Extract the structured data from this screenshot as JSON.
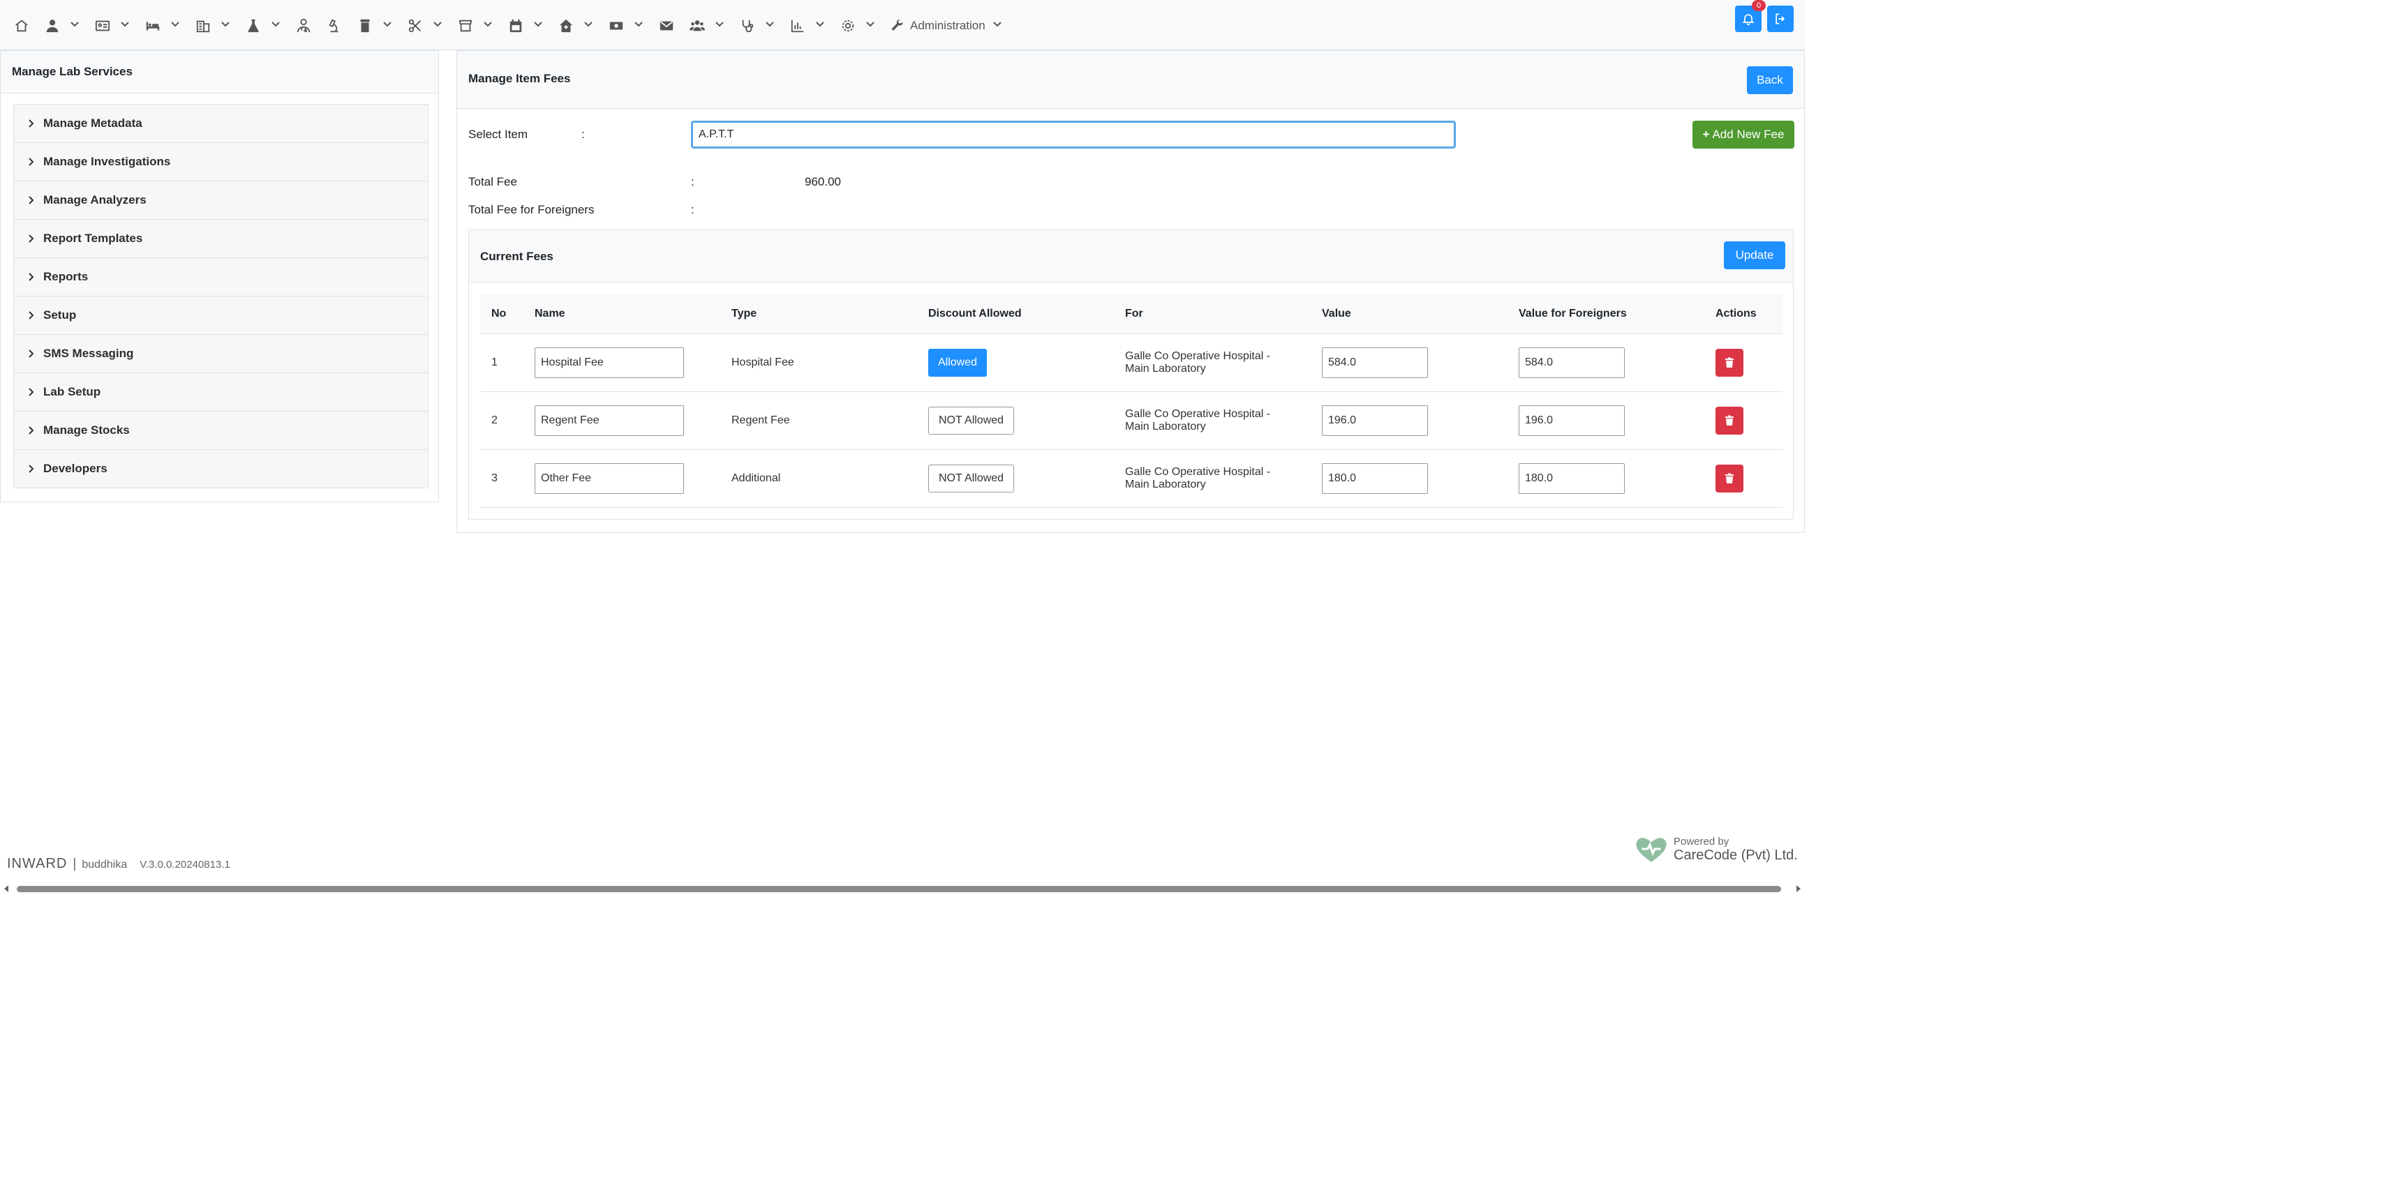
{
  "navbar": {
    "icons": [
      "home-icon",
      "user-icon",
      "id-card-icon",
      "bed-icon",
      "building-icon",
      "flask-icon",
      "user-doctor-icon",
      "microscope-icon",
      "prescription-bottle-icon",
      "scissors-icon",
      "store-icon",
      "calendar-icon",
      "house-medical-icon",
      "money-bill-icon",
      "envelope-icon",
      "users-icon",
      "stethoscope-icon",
      "chart-icon",
      "gear-icon"
    ],
    "admin_label": "Administration",
    "notification_count": "0"
  },
  "sidebar": {
    "title": "Manage Lab Services",
    "items": [
      {
        "label": "Manage Metadata"
      },
      {
        "label": "Manage Investigations"
      },
      {
        "label": "Manage Analyzers"
      },
      {
        "label": "Report Templates"
      },
      {
        "label": "Reports"
      },
      {
        "label": "Setup"
      },
      {
        "label": "SMS Messaging"
      },
      {
        "label": "Lab Setup"
      },
      {
        "label": "Manage Stocks"
      },
      {
        "label": "Developers"
      }
    ]
  },
  "main": {
    "title": "Manage Item Fees",
    "back_label": "Back",
    "select_item_label": "Select Item",
    "colon": ":",
    "select_item_value": "A.P.T.T",
    "add_new_fee_label": "Add New Fee",
    "total_fee_label": "Total Fee",
    "total_fee_value": "960.00",
    "total_fee_foreigners_label": "Total Fee for Foreigners",
    "total_fee_foreigners_value": ""
  },
  "current_fees": {
    "title": "Current Fees",
    "update_label": "Update",
    "columns": {
      "no": "No",
      "name": "Name",
      "type": "Type",
      "discount": "Discount Allowed",
      "for": "For",
      "value": "Value",
      "value_foreigners": "Value for Foreigners",
      "actions": "Actions"
    },
    "rows": [
      {
        "no": "1",
        "name": "Hospital Fee",
        "type": "Hospital Fee",
        "discount": "Allowed",
        "discount_on": true,
        "for_line1": "Galle Co Operative Hospital -",
        "for_line2": "Main Laboratory",
        "value": "584.0",
        "value_foreigners": "584.0"
      },
      {
        "no": "2",
        "name": "Regent Fee",
        "type": "Regent Fee",
        "discount": "NOT Allowed",
        "discount_on": false,
        "for_line1": "Galle Co Operative Hospital -",
        "for_line2": "Main Laboratory",
        "value": "196.0",
        "value_foreigners": "196.0"
      },
      {
        "no": "3",
        "name": "Other Fee",
        "type": "Additional",
        "discount": "NOT Allowed",
        "discount_on": false,
        "for_line1": "Galle Co Operative Hospital -",
        "for_line2": "Main Laboratory",
        "value": "180.0",
        "value_foreigners": "180.0"
      }
    ]
  },
  "footer": {
    "app": "INWARD",
    "separator": "|",
    "user": "buddhika",
    "version": "V.3.0.0.20240813.1",
    "powered_by": "Powered by",
    "company": "CareCode (Pvt) Ltd."
  },
  "colors": {
    "primary": "#1e90ff",
    "success": "#4e9a2f",
    "danger": "#dc3545"
  }
}
